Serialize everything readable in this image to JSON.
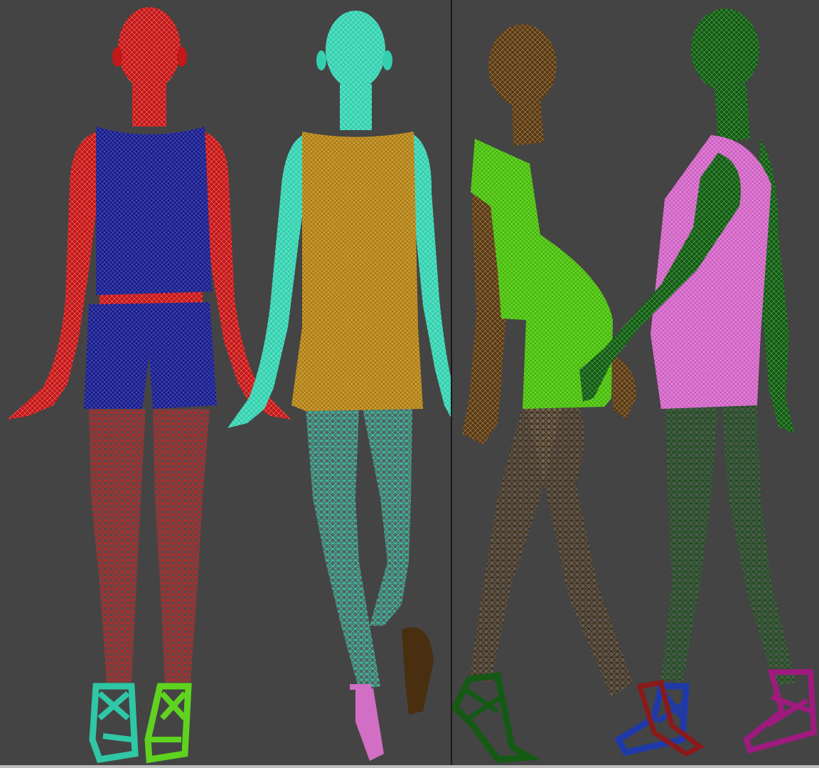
{
  "scene": {
    "background_color": "#444444",
    "divider_color": "#1a1a1a",
    "wire_pattern": "triangle-mesh"
  },
  "viewports": [
    {
      "view": "front-and-back",
      "figures": [
        {
          "pose": "front-standing",
          "body_color": "#c41818",
          "top_color": "#1a1f8a",
          "shorts_color": "#1a1f8a",
          "shoe_left_color": "#2fc7a6",
          "shoe_right_color": "#5fd31f"
        },
        {
          "pose": "back-walking",
          "body_color": "#34d1b0",
          "garment_color": "#c9982a",
          "shoe_color": "#d16fc4",
          "raised_shoe_color": "#4a2e10"
        }
      ]
    },
    {
      "view": "side",
      "figures": [
        {
          "pose": "side-walking",
          "body_color": "#5a3a14",
          "garment_color": "#5fd31f",
          "shoe_color": "#145a14"
        },
        {
          "pose": "side-walking",
          "body_color": "#145a14",
          "garment_color": "#e07ad6",
          "shoe_front_color": "#1f3aa8",
          "shoe_back_color": "#8a1a1a",
          "shoe_far_color": "#9e1a7e"
        }
      ]
    }
  ]
}
